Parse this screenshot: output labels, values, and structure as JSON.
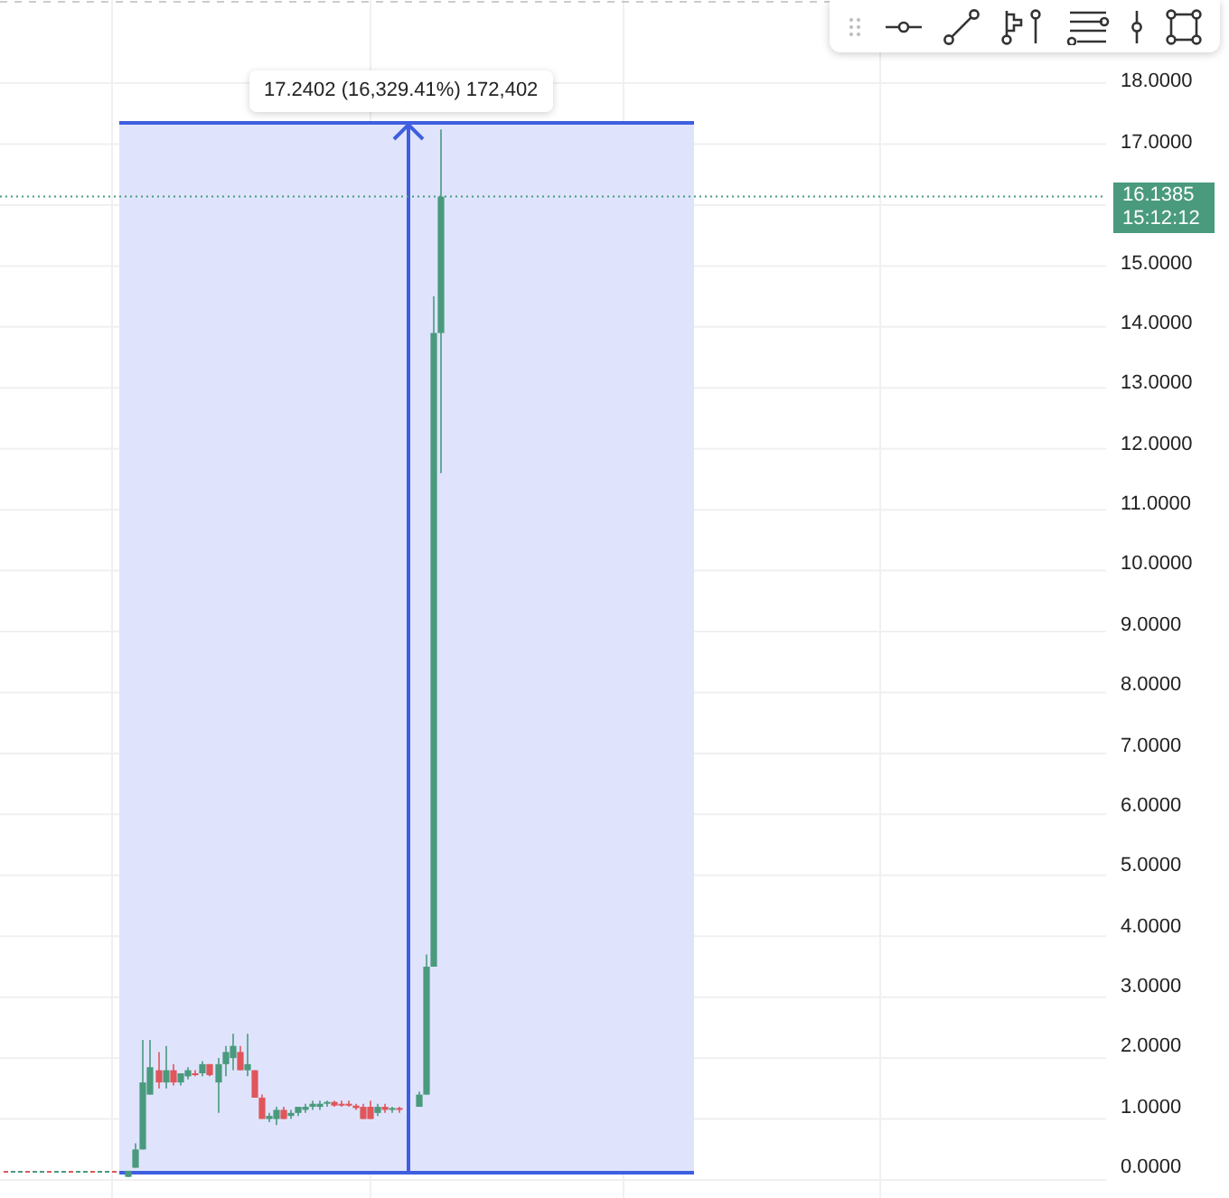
{
  "measurement": {
    "label": "17.2402 (16,329.41%) 172,402"
  },
  "last_price": {
    "price": "16.1385",
    "countdown": "15:12:12"
  },
  "price_axis": {
    "labels_above_tag": [
      "18.0000",
      "17.0000"
    ],
    "labels_below_tag": [
      "15.0000",
      "14.0000",
      "13.0000",
      "12.0000",
      "11.0000",
      "10.0000",
      "9.0000",
      "8.0000",
      "7.0000",
      "6.0000",
      "5.0000",
      "4.0000",
      "3.0000",
      "2.0000",
      "1.0000",
      "0.0000"
    ]
  }
}
